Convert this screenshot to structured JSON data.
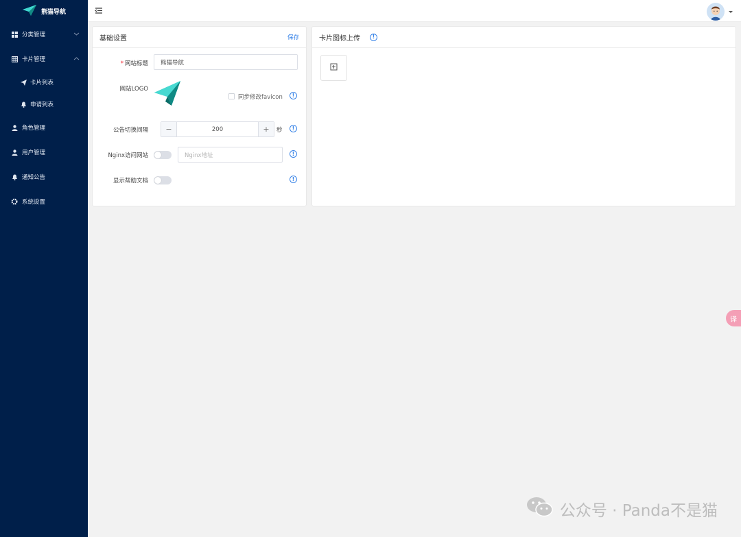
{
  "brand": {
    "name": "熊猫导航",
    "logo_icon": "paper-plane-icon"
  },
  "sidebar": {
    "items": [
      {
        "label": "分类管理",
        "icon": "grid-icon",
        "expandable": true
      },
      {
        "label": "卡片管理",
        "icon": "table-icon",
        "expandable": true,
        "expanded": true,
        "children": [
          {
            "label": "卡片列表",
            "icon": "send-icon"
          },
          {
            "label": "申请列表",
            "icon": "bell-icon"
          }
        ]
      },
      {
        "label": "角色管理",
        "icon": "user-icon"
      },
      {
        "label": "用户管理",
        "icon": "user-icon"
      },
      {
        "label": "通知公告",
        "icon": "bell-icon"
      },
      {
        "label": "系统设置",
        "icon": "gear-icon"
      }
    ]
  },
  "header": {
    "fold_icon": "menu-fold-icon",
    "avatar_icon": "avatar-icon"
  },
  "basic": {
    "title": "基础设置",
    "save_label": "保存",
    "site_title_label": "网站标题",
    "site_title_value": "熊猫导航",
    "logo_label": "网站LOGO",
    "sync_favicon_label": "同步修改favicon",
    "sync_favicon_checked": false,
    "notice_interval_label": "公告切换间隔",
    "notice_interval_value": "200",
    "notice_interval_unit": "秒",
    "nginx_label": "Nginx访问网站",
    "nginx_enabled": false,
    "nginx_placeholder": "Nginx地址",
    "help_doc_label": "显示帮助文档",
    "help_doc_enabled": false
  },
  "upload": {
    "title": "卡片图标上传",
    "upload_icon": "image-upload-icon"
  },
  "watermark": {
    "text": "公众号 · Panda不是猫",
    "icon": "wechat-icon"
  },
  "floating": {
    "label": "译",
    "icon": "translate-icon"
  },
  "colors": {
    "sidebar_bg": "#001f4a",
    "accent": "#3a85e8",
    "logo_teal": "#1aa8a0"
  }
}
